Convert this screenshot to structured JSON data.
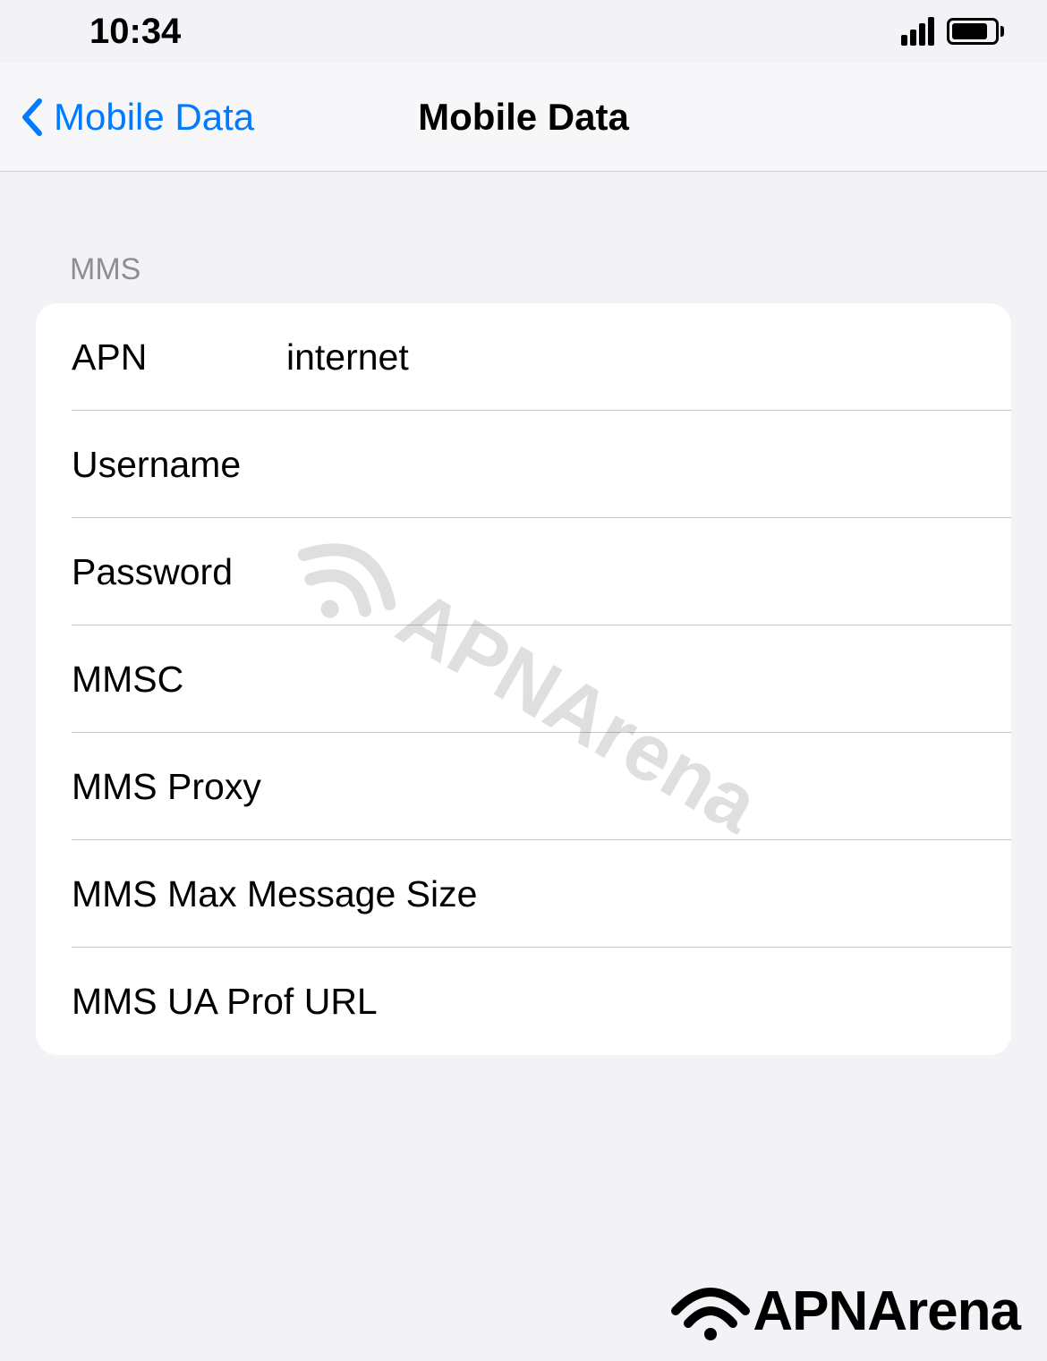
{
  "status_bar": {
    "time": "10:34"
  },
  "nav": {
    "back_label": "Mobile Data",
    "title": "Mobile Data"
  },
  "section": {
    "header": "MMS"
  },
  "fields": {
    "apn": {
      "label": "APN",
      "value": "internet"
    },
    "username": {
      "label": "Username",
      "value": ""
    },
    "password": {
      "label": "Password",
      "value": ""
    },
    "mmsc": {
      "label": "MMSC",
      "value": ""
    },
    "mms_proxy": {
      "label": "MMS Proxy",
      "value": ""
    },
    "mms_max_size": {
      "label": "MMS Max Message Size",
      "value": ""
    },
    "mms_ua_prof": {
      "label": "MMS UA Prof URL",
      "value": ""
    }
  },
  "watermark": {
    "text": "APNArena"
  },
  "footer": {
    "text": "APNArena"
  }
}
